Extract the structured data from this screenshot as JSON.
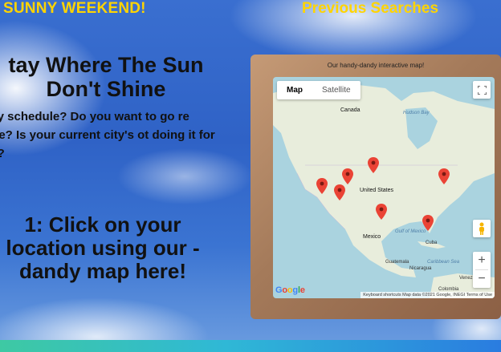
{
  "header": {
    "site_title": "SUNNY WEEKEND!",
    "previous_searches": "Previous Searches"
  },
  "hero": {
    "title": "tay Where The Sun Don't Shine",
    "text": "busy schedule? Do you want to go re more? Is your current city's ot doing it for you?",
    "step": "1: Click on your location using our -dandy map here!"
  },
  "map": {
    "caption": "Our handy-dandy interactive map!",
    "type_map": "Map",
    "type_satellite": "Satellite",
    "zoom_in": "+",
    "zoom_out": "−",
    "google": "Google",
    "attribution": "Keyboard shortcuts   Map data ©2021 Google, INEGI   Terms of Use",
    "labels": {
      "canada": "Canada",
      "hudson_bay": "Hudson Bay",
      "united_states": "United States",
      "mexico": "Mexico",
      "gulf_of_mexico": "Gulf of Mexico",
      "cuba": "Cuba",
      "caribbean_sea": "Caribbean Sea",
      "guatemala": "Guatemala",
      "nicaragua": "Nicaragua",
      "venezuela": "Venezuela",
      "colombia": "Colombia"
    },
    "marker_count": 7
  },
  "colors": {
    "title_yellow": "#ffd400",
    "marker_red": "#ea4335"
  }
}
